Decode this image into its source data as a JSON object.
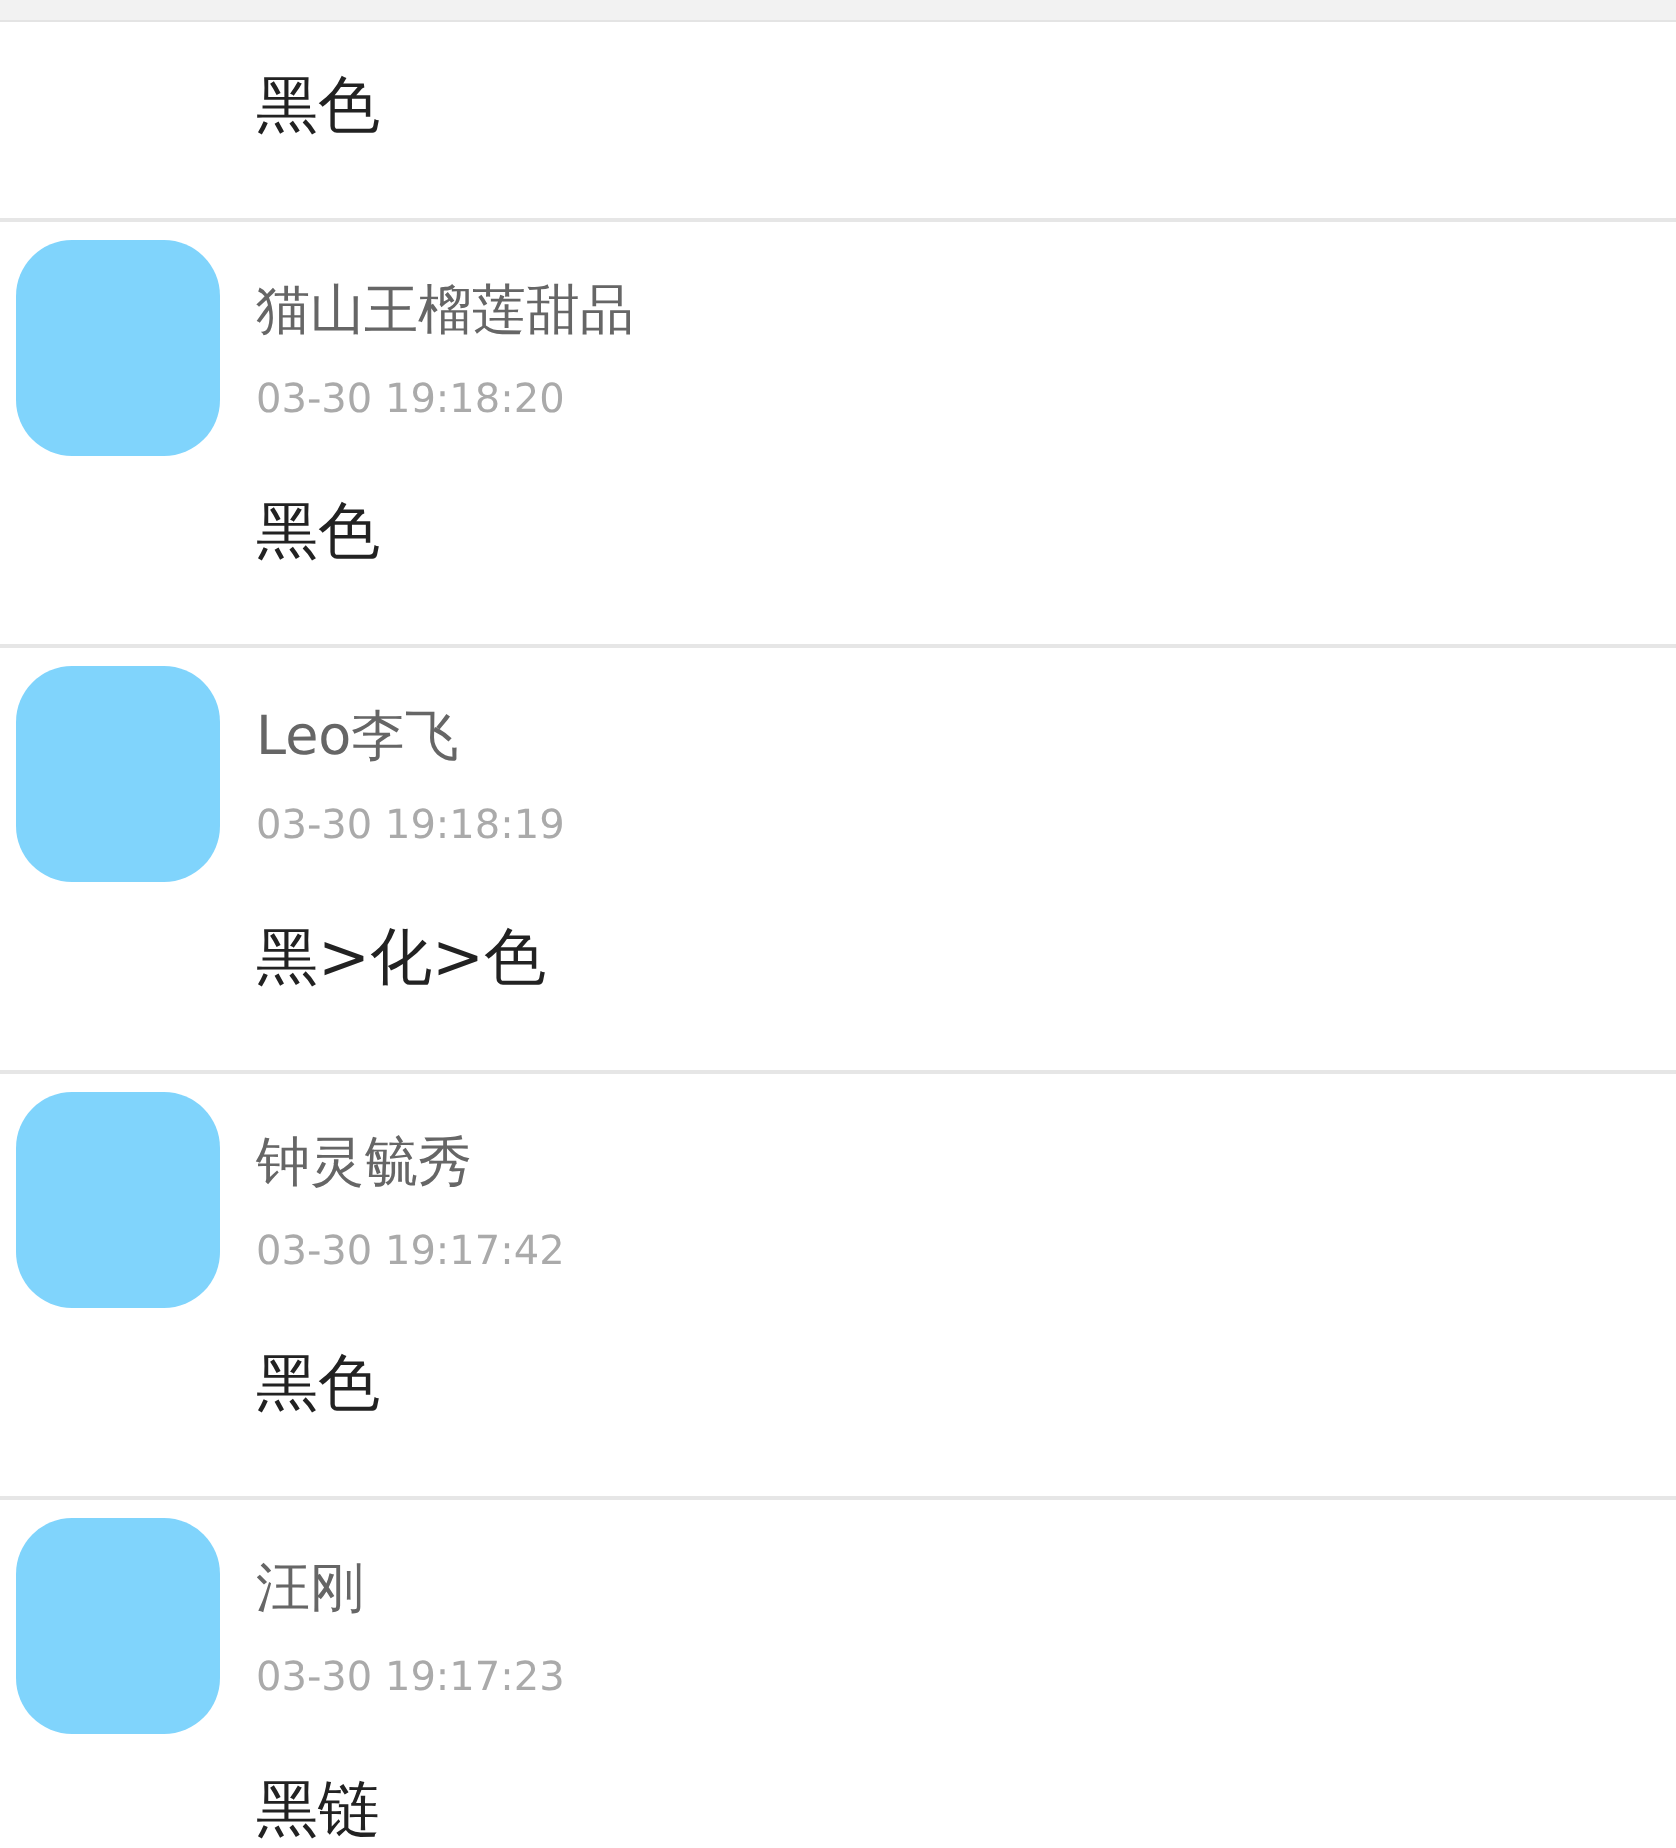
{
  "comments": [
    {
      "kind": "tail",
      "text": "黑色"
    },
    {
      "kind": "full",
      "name": "猫山王榴莲甜品",
      "time": "03-30 19:18:20",
      "text": "黑色"
    },
    {
      "kind": "full",
      "name": "Leo李飞",
      "time": "03-30 19:18:19",
      "text": "黑>化>色"
    },
    {
      "kind": "full",
      "name": "钟灵毓秀",
      "time": "03-30 19:17:42",
      "text": "黑色"
    },
    {
      "kind": "full",
      "name": "汪刚",
      "time": "03-30 19:17:23",
      "text": "黑链"
    }
  ]
}
